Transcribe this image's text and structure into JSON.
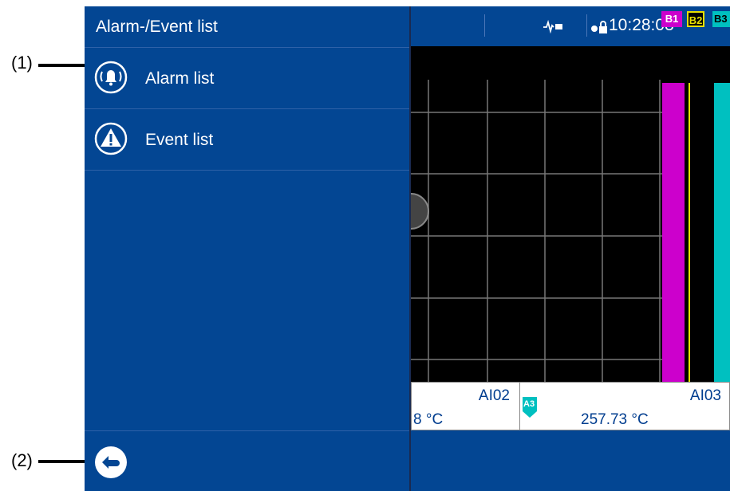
{
  "callouts": {
    "one": "(1)",
    "two": "(2)"
  },
  "menu": {
    "title": "Alarm-/Event list",
    "items": [
      {
        "label": "Alarm list",
        "icon": "alarm-bell-icon"
      },
      {
        "label": "Event list",
        "icon": "warning-triangle-icon"
      }
    ],
    "back_icon": "back-arrow-icon"
  },
  "status": {
    "time": "10:28:03"
  },
  "channels": {
    "tags": [
      "B1",
      "B2",
      "B3"
    ],
    "colors": {
      "B1": "#cc00cc",
      "B2": "#e8e000",
      "B3": "#00c0c0"
    },
    "panel_a": {
      "name": "AI02",
      "value": "8 °C"
    },
    "panel_b": {
      "name": "AI03",
      "tag": "A3",
      "value": "257.73 °C"
    }
  }
}
